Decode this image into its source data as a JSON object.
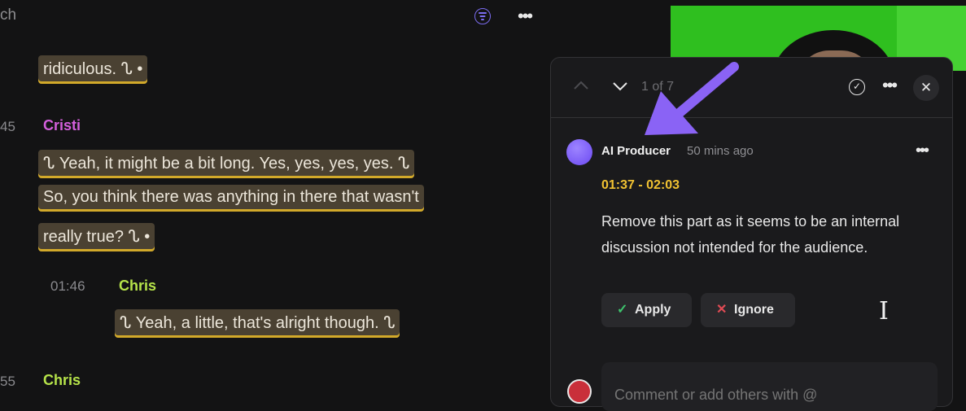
{
  "transcript": {
    "search_fragment": "ch",
    "filter_icon": "filter-icon",
    "more_icon": "more-horizontal-icon",
    "entries": [
      {
        "lines": [
          "ridiculous. ᔐ •"
        ]
      },
      {
        "timestamp": "45",
        "speaker": "Cristi",
        "speaker_color": "#d45fdc",
        "lines": [
          "ᔐ Yeah, it might be a bit long. Yes, yes, yes, yes. ᔐ",
          "So, you think there was anything in there that wasn't",
          "really true? ᔐ •"
        ]
      },
      {
        "timestamp": "01:46",
        "speaker": "Chris",
        "speaker_color": "#b6e34a",
        "lines": [
          "ᔐ Yeah, a little, that's alright though. ᔐ"
        ]
      },
      {
        "timestamp": "55",
        "speaker": "Chris",
        "speaker_color": "#b6e34a"
      }
    ]
  },
  "review_panel": {
    "counter": "1 of 7",
    "prev_icon": "chevron-up-icon",
    "next_icon": "chevron-down-icon",
    "resolve_icon": "check-circle-icon",
    "close_icon": "close-icon",
    "comment": {
      "author": "AI Producer",
      "time_ago": "50 mins ago",
      "time_range": "01:37 - 02:03",
      "message": "Remove this part as it seems to be an internal discussion not intended for the audience.",
      "apply_label": "Apply",
      "ignore_label": "Ignore"
    },
    "comment_input_placeholder": "Comment or add others with @"
  },
  "colors": {
    "accent": "#7b6cf0",
    "highlight_underline": "#d2a92a",
    "time_range": "#f1c232",
    "apply_check": "#3ec46d",
    "ignore_x": "#e04b54",
    "annotation_arrow": "#8a63f5"
  }
}
